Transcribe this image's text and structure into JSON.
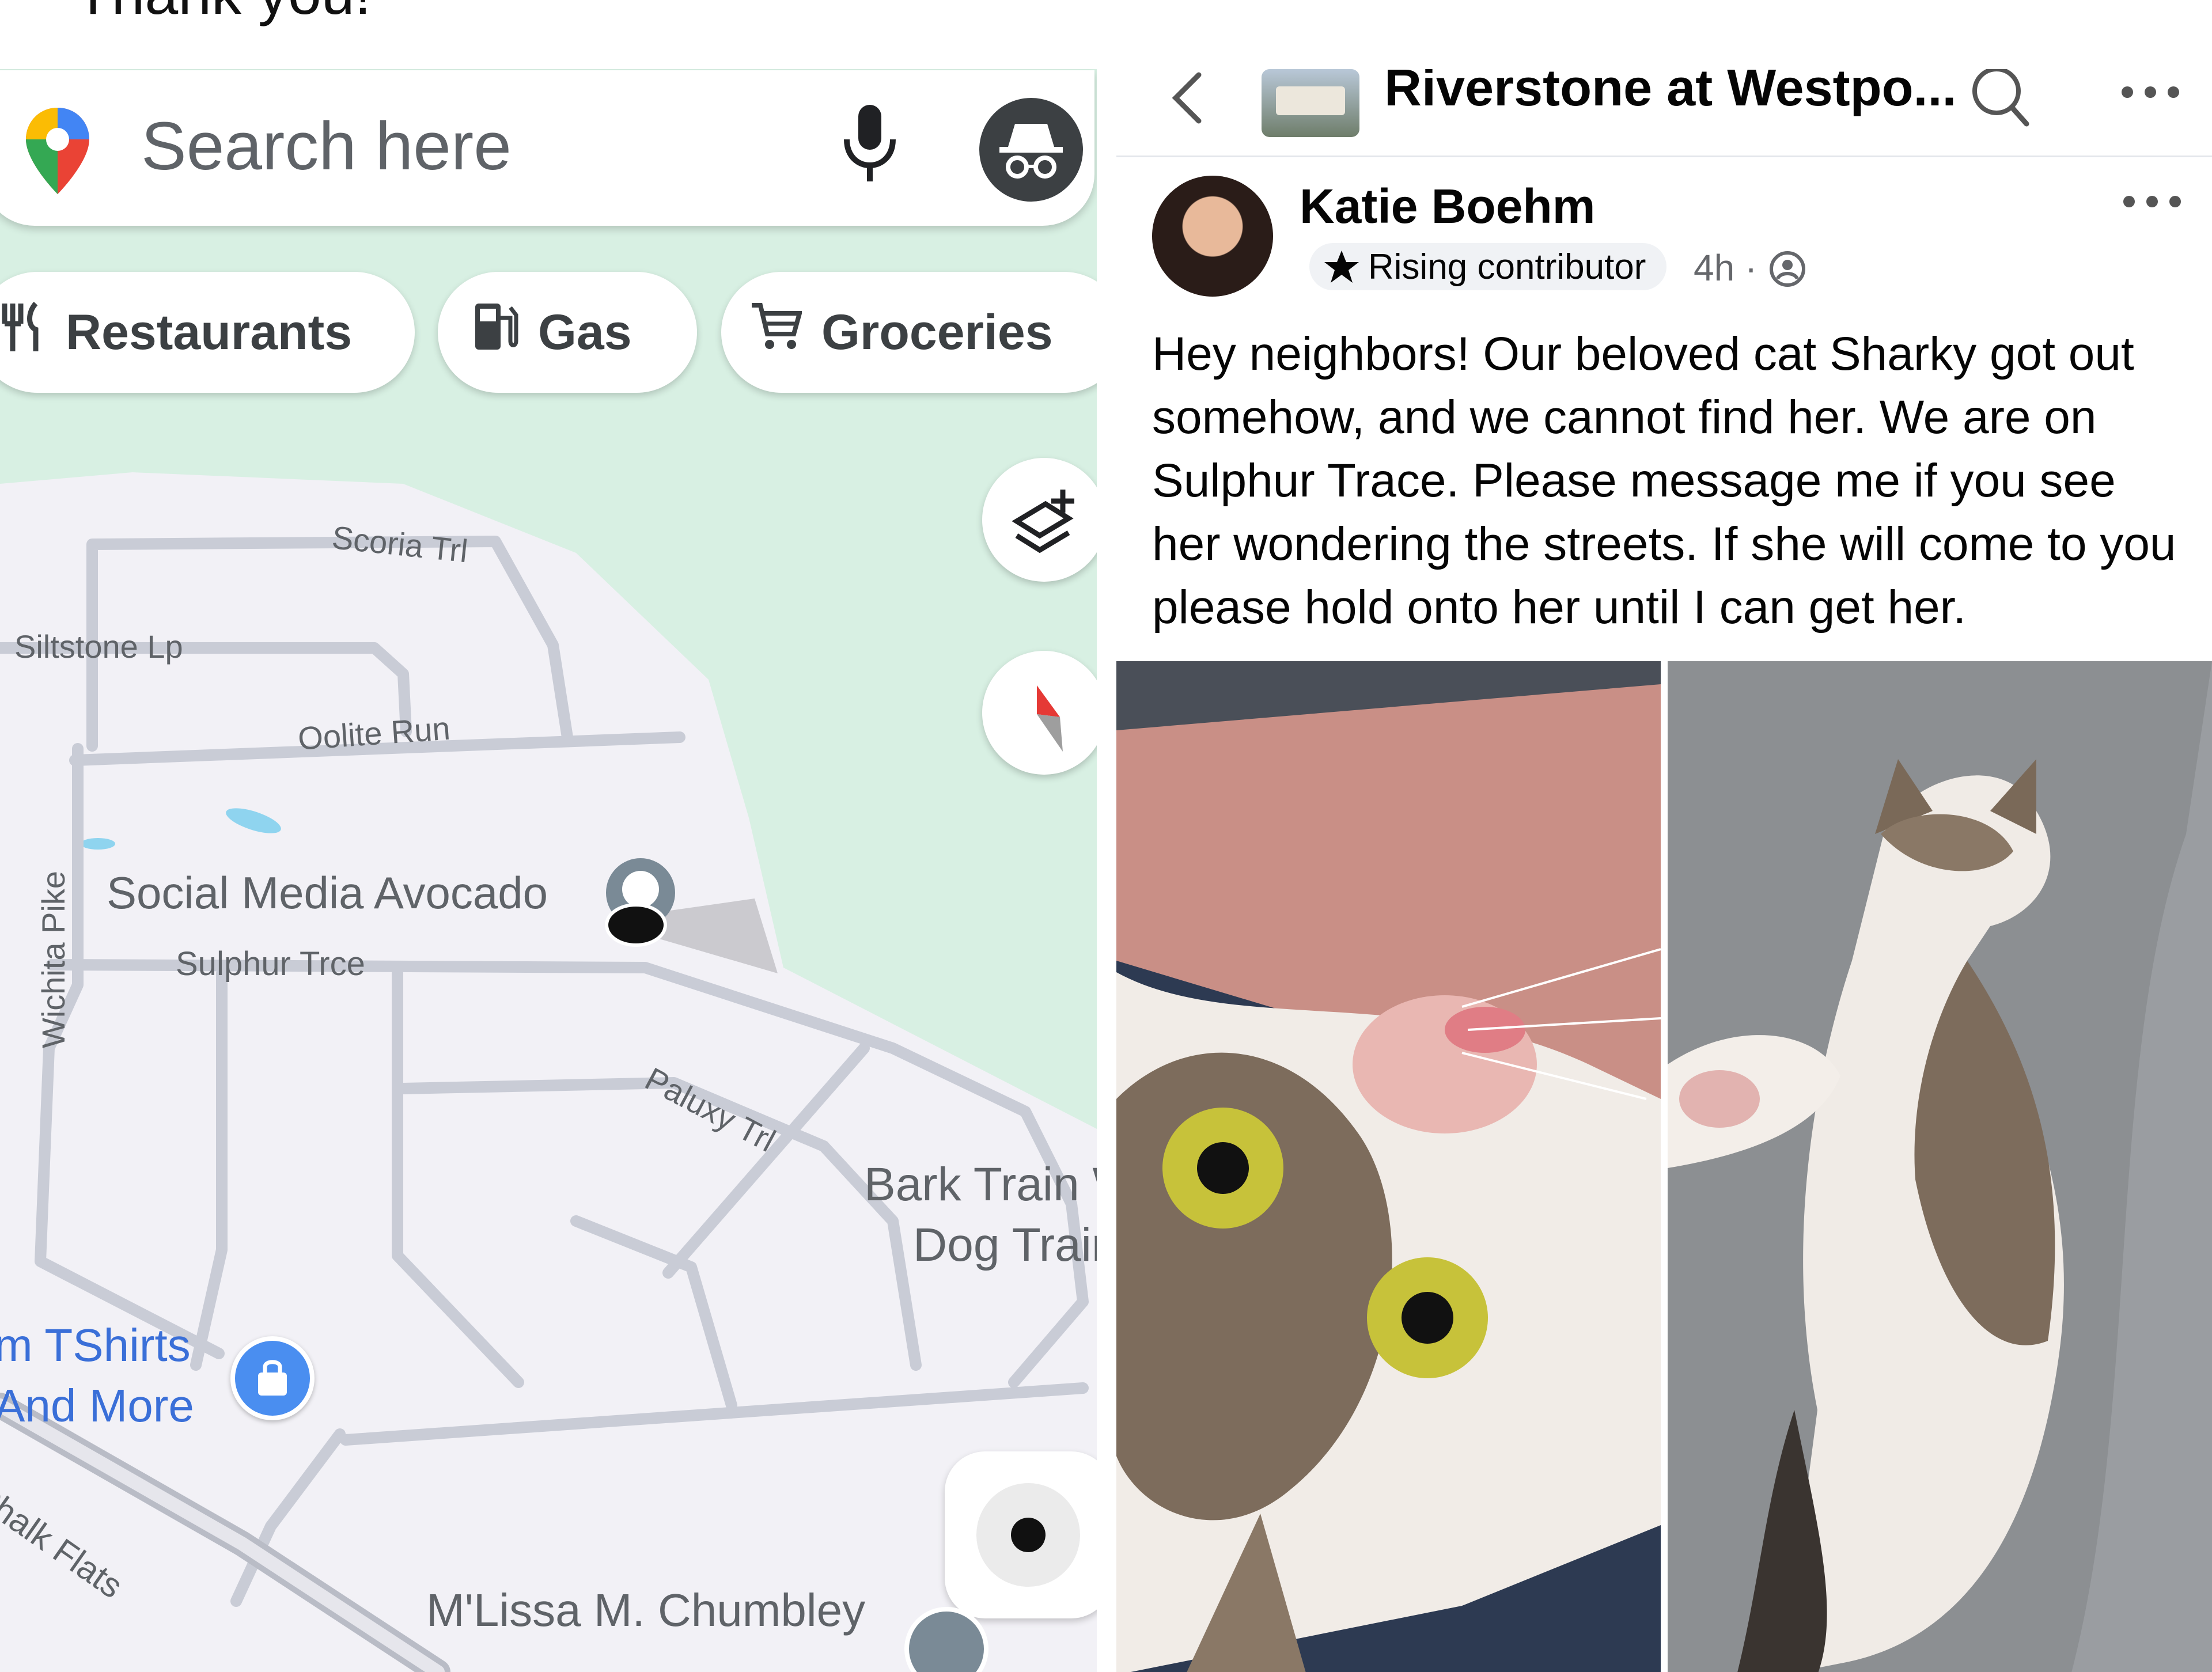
{
  "caption": {
    "text": "Thank you!"
  },
  "maps": {
    "search": {
      "placeholder": "Search here",
      "icons": [
        "maps-pin-icon",
        "microphone-icon",
        "incognito-icon"
      ]
    },
    "chips": [
      {
        "label": "Restaurants",
        "icon": "fork-knife-icon"
      },
      {
        "label": "Gas",
        "icon": "gas-pump-icon"
      },
      {
        "label": "Groceries",
        "icon": "cart-icon"
      }
    ],
    "streets": {
      "scoria": "Scoria Trl",
      "siltstone": "Siltstone Lp",
      "oolite": "Oolite Run",
      "wichita": "Wichita Pike",
      "sulphur": "Sulphur Trce",
      "paluxy": "Paluxy Trl",
      "chalk": "Chalk Flats"
    },
    "places": {
      "avocado": "Social Media Avocado",
      "bark_line1": "Bark Train W",
      "bark_line2": "Dog Train",
      "tshirts_line1": "m TShirts",
      "tshirts_line2": "And More",
      "school": "M'Lissa M. Chumbley"
    },
    "colors": {
      "map_bg": "#f2f1f6",
      "park": "#d8f0e3",
      "road": "#c9ccd6",
      "water": "#8fd4ef",
      "poi_blue": "#4a8ef0"
    }
  },
  "facebook": {
    "group_title": "Riverstone at Westpo...",
    "author": "Katie Boehm",
    "badge": "Rising contributor",
    "meta": "4h · ",
    "post_text": "Hey neighbors! Our beloved cat Sharky got out somehow, and we cannot find her. We are on Sulphur Trace. Please message me if you see her wondering the streets. If she will come to you please hold onto her until I can get her."
  }
}
